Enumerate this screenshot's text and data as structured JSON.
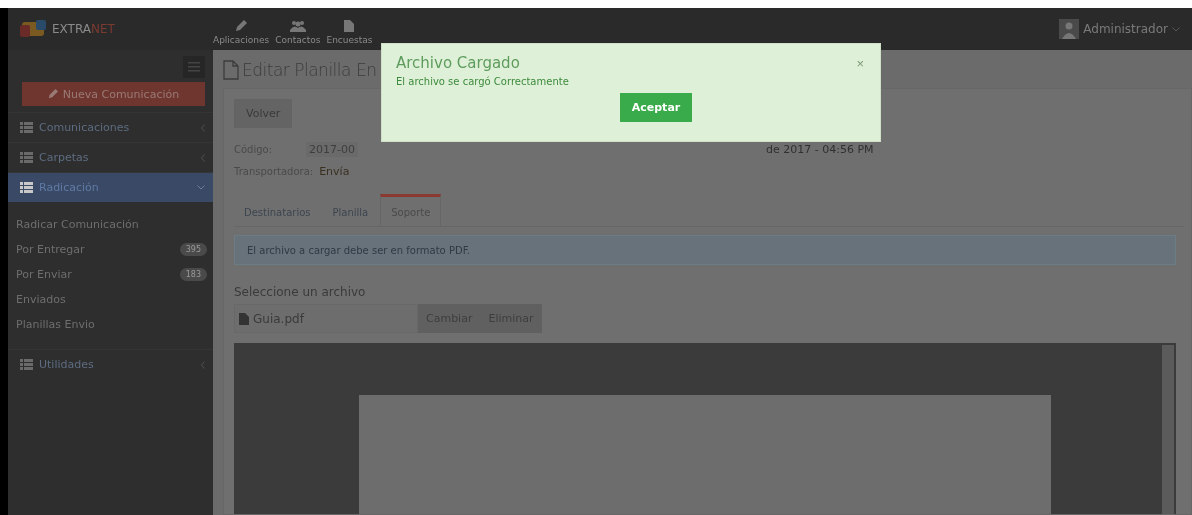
{
  "navbar": {
    "brand_left": "EXTRA",
    "brand_right": "NET",
    "apps": [
      {
        "label": "Aplicaciones",
        "kind": "pencil"
      },
      {
        "label": "Contactos",
        "kind": "people"
      },
      {
        "label": "Encuestas",
        "kind": "file"
      }
    ],
    "user": "Administrador"
  },
  "sidebar": {
    "new_button": "Nueva Comunicación",
    "items": [
      {
        "label": "Comunicaciones",
        "expanded": false
      },
      {
        "label": "Carpetas",
        "expanded": false
      },
      {
        "label": "Radicación",
        "expanded": true,
        "children": [
          {
            "label": "Radicar Comunicación"
          },
          {
            "label": "Por Entregar",
            "badge": "395"
          },
          {
            "label": "Por Enviar",
            "badge": "183"
          },
          {
            "label": "Enviados"
          },
          {
            "label": "Planillas Envio"
          }
        ]
      },
      {
        "label": "Utilidades",
        "expanded": false
      }
    ]
  },
  "page": {
    "title": "Editar Planilla En",
    "back_button": "Volver",
    "code_label": "Código:",
    "code_value": "2017-00",
    "date_value": "de 2017 - 04:56 PM",
    "carrier_label": "Transportadora:",
    "carrier_value": "Envía",
    "tabs": [
      {
        "label": "Destinatarios",
        "selected": false
      },
      {
        "label": "Planilla",
        "selected": false
      },
      {
        "label": "Soporte",
        "selected": true
      }
    ],
    "info": "El archivo a cargar debe ser en formato PDF.",
    "file_label": "Seleccione un archivo",
    "file_name": "Guia.pdf",
    "file_buttons": [
      "Cambiar",
      "Eliminar"
    ]
  },
  "modal": {
    "title": "Archivo Cargado",
    "message": "El archivo se cargó Correctamente",
    "close": "×",
    "button": "Aceptar"
  }
}
